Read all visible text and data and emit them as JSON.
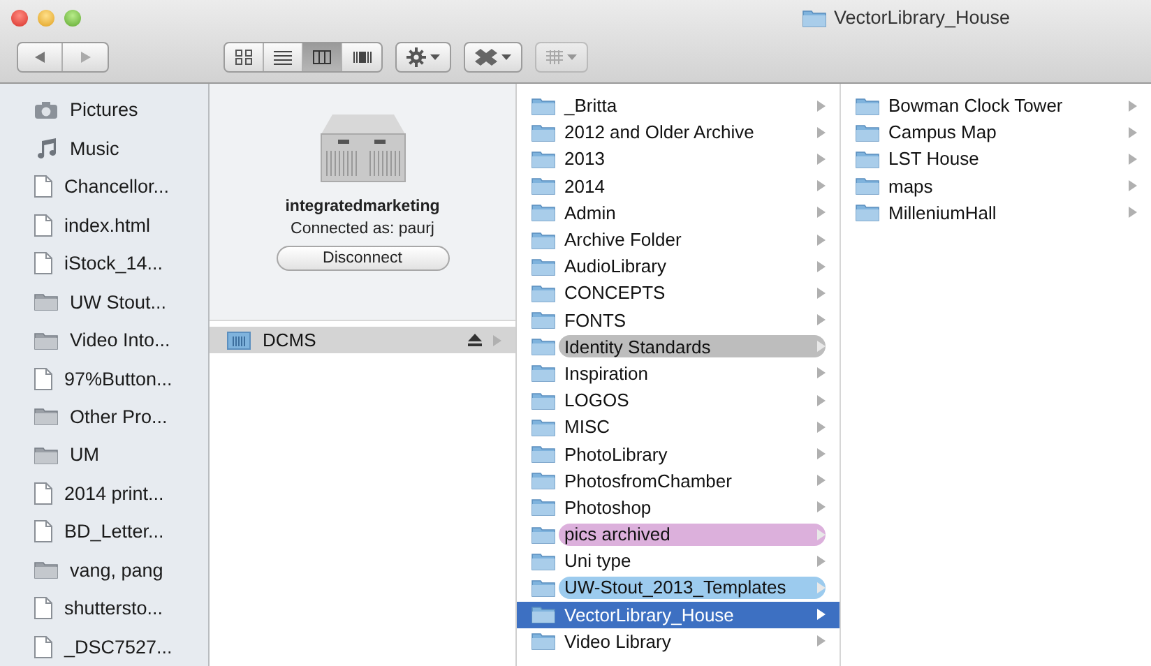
{
  "window": {
    "title": "VectorLibrary_House"
  },
  "toolbar": {
    "views": [
      {
        "kind": "icon",
        "selected": false
      },
      {
        "kind": "list",
        "selected": false
      },
      {
        "kind": "column",
        "selected": true
      },
      {
        "kind": "coverflow",
        "selected": false
      }
    ],
    "arrange": {
      "disabled": true
    }
  },
  "sidebar": {
    "items": [
      {
        "label": "Pictures",
        "kind": "pictures"
      },
      {
        "label": "Music",
        "kind": "music"
      },
      {
        "label": "Chancellor...",
        "kind": "file"
      },
      {
        "label": "index.html",
        "kind": "file"
      },
      {
        "label": "iStock_14...",
        "kind": "file"
      },
      {
        "label": "UW Stout...",
        "kind": "folder"
      },
      {
        "label": "Video Into...",
        "kind": "folder"
      },
      {
        "label": "97%Button...",
        "kind": "file"
      },
      {
        "label": "Other Pro...",
        "kind": "folder"
      },
      {
        "label": "UM",
        "kind": "folder"
      },
      {
        "label": "2014 print...",
        "kind": "file"
      },
      {
        "label": "BD_Letter...",
        "kind": "file"
      },
      {
        "label": "vang, pang",
        "kind": "folder"
      },
      {
        "label": "shuttersto...",
        "kind": "file"
      },
      {
        "label": "_DSC7527...",
        "kind": "file"
      }
    ]
  },
  "server": {
    "name": "integratedmarketing",
    "connected_as": "Connected as: paurj",
    "button": "Disconnect",
    "items": [
      {
        "label": "DCMS",
        "selected": true
      }
    ]
  },
  "columns": [
    {
      "items": [
        {
          "label": "_Britta",
          "selected": false
        },
        {
          "label": "2012 and Older Archive",
          "selected": false
        },
        {
          "label": "2013",
          "selected": false
        },
        {
          "label": "2014",
          "selected": false
        },
        {
          "label": "Admin",
          "selected": false
        },
        {
          "label": "Archive Folder",
          "selected": false
        },
        {
          "label": "AudioLibrary",
          "selected": false
        },
        {
          "label": "CONCEPTS",
          "selected": false
        },
        {
          "label": "FONTS",
          "selected": false
        },
        {
          "label": "Identity Standards",
          "selected": false,
          "color": "#bdbdbd"
        },
        {
          "label": "Inspiration",
          "selected": false
        },
        {
          "label": "LOGOS",
          "selected": false
        },
        {
          "label": "MISC",
          "selected": false
        },
        {
          "label": "PhotoLibrary",
          "selected": false
        },
        {
          "label": "PhotosfromChamber",
          "selected": false
        },
        {
          "label": "Photoshop",
          "selected": false
        },
        {
          "label": "pics archived",
          "selected": false,
          "color": "#dcb0dc"
        },
        {
          "label": "Uni type",
          "selected": false
        },
        {
          "label": "UW-Stout_2013_Templates",
          "selected": false,
          "color": "#9ccbee"
        },
        {
          "label": "VectorLibrary_House",
          "selected": true
        },
        {
          "label": "Video Library",
          "selected": false
        }
      ]
    },
    {
      "items": [
        {
          "label": "Bowman Clock Tower",
          "selected": false
        },
        {
          "label": "Campus Map",
          "selected": false
        },
        {
          "label": "LST House",
          "selected": false
        },
        {
          "label": "maps",
          "selected": false
        },
        {
          "label": "MilleniumHall",
          "selected": false
        }
      ]
    }
  ]
}
